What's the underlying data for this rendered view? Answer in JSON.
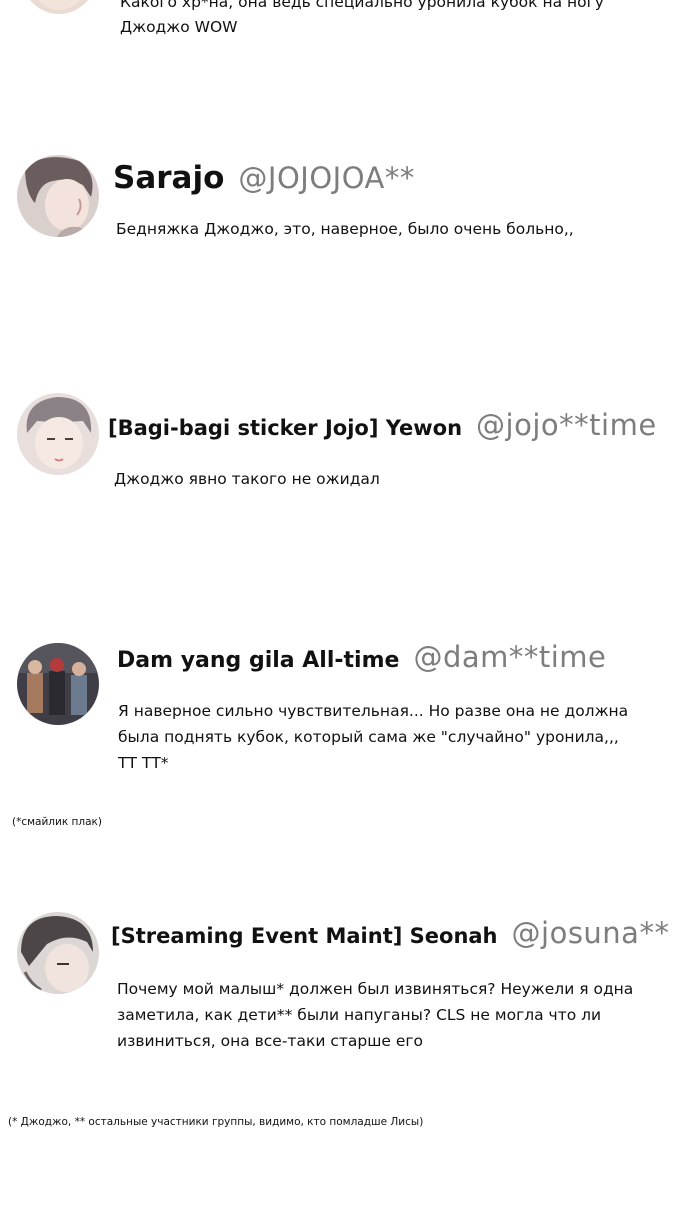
{
  "top_comment": {
    "text": "Какого хр*на, она ведь специально уронила кубок на ногу Джоджо WOW"
  },
  "comments": [
    {
      "name": "Sarajo",
      "handle": "@JOJOJOA**",
      "text": "Бедняжка Джоджо, это, наверное, было очень больно,,"
    },
    {
      "name": "[Bagi-bagi sticker Jojo] Yewon",
      "handle": "@jojo**time",
      "text": "Джоджо явно такого не ожидал"
    },
    {
      "name": "Dam yang gila All-time",
      "handle": "@dam**time",
      "text": "Я наверное сильно чувствительная... Но разве она не должна была поднять кубок, который сама же \"случайно\" уронила,,, ТТ ТТ*"
    },
    {
      "name": "[Streaming Event Maint] Seonah",
      "handle": "@josuna**",
      "text": "Почему мой малыш* должен был извиняться? Неужели я одна заметила, как дети** были напуганы? CLS не могла что ли извиниться, она все-таки старше его"
    }
  ],
  "footnotes": {
    "crying_emoticon": "(*смайлик плак)",
    "jojo_note": "(* Джоджо, ** остальные участники группы, видимо, кто помладше Лисы)"
  },
  "colors": {
    "background": "#ffffff",
    "name_text": "#111111",
    "handle_text": "#7d7d7d"
  }
}
